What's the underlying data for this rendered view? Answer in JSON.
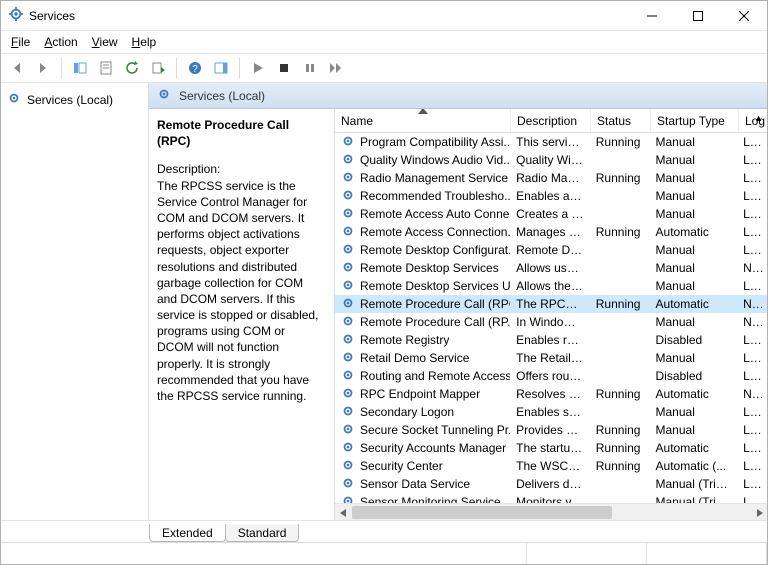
{
  "window": {
    "title": "Services"
  },
  "menu": {
    "file": "File",
    "action": "Action",
    "view": "View",
    "help": "Help"
  },
  "nav": {
    "root": "Services (Local)"
  },
  "contentHeader": "Services (Local)",
  "selectedService": {
    "name": "Remote Procedure Call (RPC)",
    "descLabel": "Description:",
    "description": "The RPCSS service is the Service Control Manager for COM and DCOM servers. It performs object activations requests, object exporter resolutions and distributed garbage collection for COM and DCOM servers. If this service is stopped or disabled, programs using COM or DCOM will not function properly. It is strongly recommended that you have the RPCSS service running."
  },
  "columns": {
    "name": "Name",
    "description": "Description",
    "status": "Status",
    "startup": "Startup Type",
    "logon": "Log"
  },
  "tabs": {
    "extended": "Extended",
    "standard": "Standard"
  },
  "services": [
    {
      "name": "Program Compatibility Assi...",
      "description": "This service ...",
      "status": "Running",
      "startup": "Manual",
      "logon": "Loca"
    },
    {
      "name": "Quality Windows Audio Vid...",
      "description": "Quality Win...",
      "status": "",
      "startup": "Manual",
      "logon": "Loca"
    },
    {
      "name": "Radio Management Service",
      "description": "Radio Mana...",
      "status": "Running",
      "startup": "Manual",
      "logon": "Loca"
    },
    {
      "name": "Recommended Troublesho...",
      "description": "Enables aut...",
      "status": "",
      "startup": "Manual",
      "logon": "Loca"
    },
    {
      "name": "Remote Access Auto Conne...",
      "description": "Creates a co...",
      "status": "",
      "startup": "Manual",
      "logon": "Loca"
    },
    {
      "name": "Remote Access Connection...",
      "description": "Manages di...",
      "status": "Running",
      "startup": "Automatic",
      "logon": "Loca"
    },
    {
      "name": "Remote Desktop Configurat...",
      "description": "Remote Des...",
      "status": "",
      "startup": "Manual",
      "logon": "Loca"
    },
    {
      "name": "Remote Desktop Services",
      "description": "Allows user...",
      "status": "",
      "startup": "Manual",
      "logon": "Netw"
    },
    {
      "name": "Remote Desktop Services U...",
      "description": "Allows the r...",
      "status": "",
      "startup": "Manual",
      "logon": "Loca"
    },
    {
      "name": "Remote Procedure Call (RPC)",
      "description": "The RPCSS s...",
      "status": "Running",
      "startup": "Automatic",
      "logon": "Netw",
      "selected": true
    },
    {
      "name": "Remote Procedure Call (RP...",
      "description": "In Windows...",
      "status": "",
      "startup": "Manual",
      "logon": "Netw"
    },
    {
      "name": "Remote Registry",
      "description": "Enables rem...",
      "status": "",
      "startup": "Disabled",
      "logon": "Loca"
    },
    {
      "name": "Retail Demo Service",
      "description": "The Retail D...",
      "status": "",
      "startup": "Manual",
      "logon": "Loca"
    },
    {
      "name": "Routing and Remote Access",
      "description": "Offers routi...",
      "status": "",
      "startup": "Disabled",
      "logon": "Loca"
    },
    {
      "name": "RPC Endpoint Mapper",
      "description": "Resolves RP...",
      "status": "Running",
      "startup": "Automatic",
      "logon": "Netw"
    },
    {
      "name": "Secondary Logon",
      "description": "Enables star...",
      "status": "",
      "startup": "Manual",
      "logon": "Loca"
    },
    {
      "name": "Secure Socket Tunneling Pr...",
      "description": "Provides su...",
      "status": "Running",
      "startup": "Manual",
      "logon": "Loca"
    },
    {
      "name": "Security Accounts Manager",
      "description": "The startup ...",
      "status": "Running",
      "startup": "Automatic",
      "logon": "Loca"
    },
    {
      "name": "Security Center",
      "description": "The WSCSV...",
      "status": "Running",
      "startup": "Automatic (...",
      "logon": "Loca"
    },
    {
      "name": "Sensor Data Service",
      "description": "Delivers dat...",
      "status": "",
      "startup": "Manual (Trig...",
      "logon": "Loca"
    },
    {
      "name": "Sensor Monitoring Service",
      "description": "Monitors va...",
      "status": "",
      "startup": "Manual (Trig...",
      "logon": "Loca"
    }
  ]
}
